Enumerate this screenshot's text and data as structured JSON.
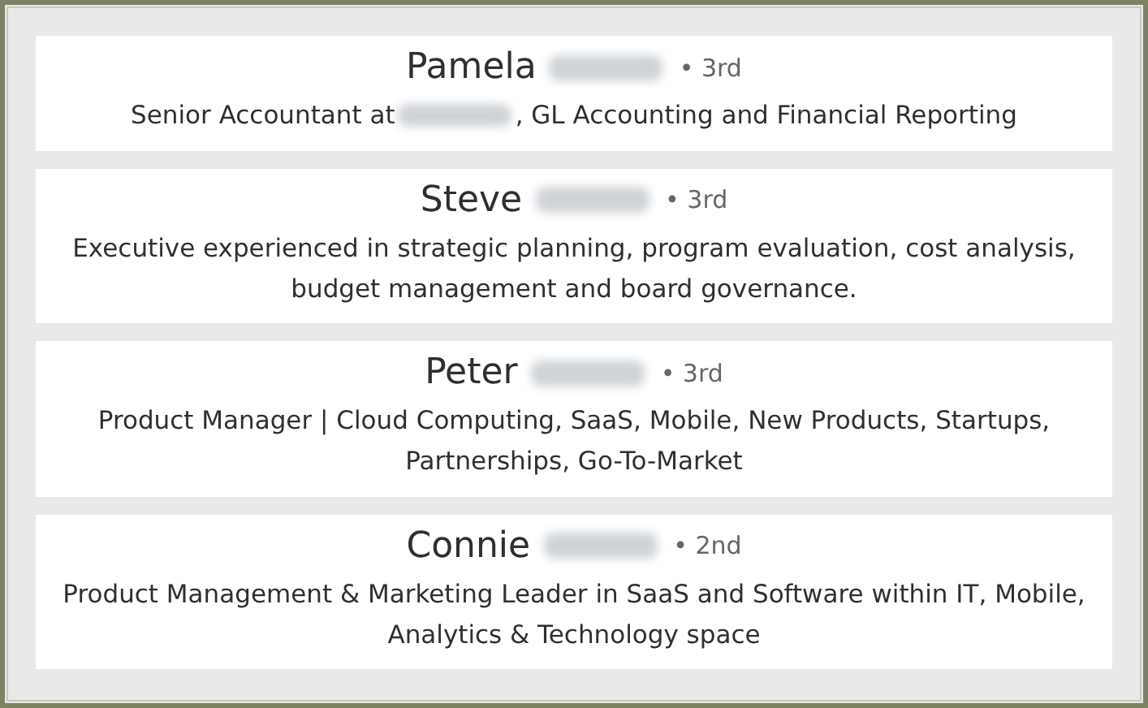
{
  "profiles": [
    {
      "name": [
        {
          "kind": "text",
          "text": "Pamela"
        },
        {
          "kind": "redacted"
        }
      ],
      "degree": "• 3rd",
      "headline": [
        {
          "kind": "text",
          "text": "Senior Accountant at"
        },
        {
          "kind": "redacted"
        },
        {
          "kind": "text",
          "text": ", GL Accounting and Financial Reporting"
        }
      ]
    },
    {
      "name": [
        {
          "kind": "text",
          "text": "Steve"
        },
        {
          "kind": "redacted"
        }
      ],
      "degree": "• 3rd",
      "headline": [
        {
          "kind": "text",
          "text": "Executive experienced in strategic planning, program evaluation, cost analysis, budget management and board governance."
        }
      ]
    },
    {
      "name": [
        {
          "kind": "text",
          "text": "Peter"
        },
        {
          "kind": "redacted"
        }
      ],
      "degree": "• 3rd",
      "headline": [
        {
          "kind": "text",
          "text": "Product Manager | Cloud Computing, SaaS, Mobile, New Products, Startups, Partnerships, Go-To-Market"
        }
      ]
    },
    {
      "name": [
        {
          "kind": "text",
          "text": "Connie"
        },
        {
          "kind": "redacted"
        }
      ],
      "degree": "• 2nd",
      "headline": [
        {
          "kind": "text",
          "text": "Product Management & Marketing Leader in SaaS and Software within IT, Mobile, Analytics & Technology space"
        }
      ]
    }
  ]
}
